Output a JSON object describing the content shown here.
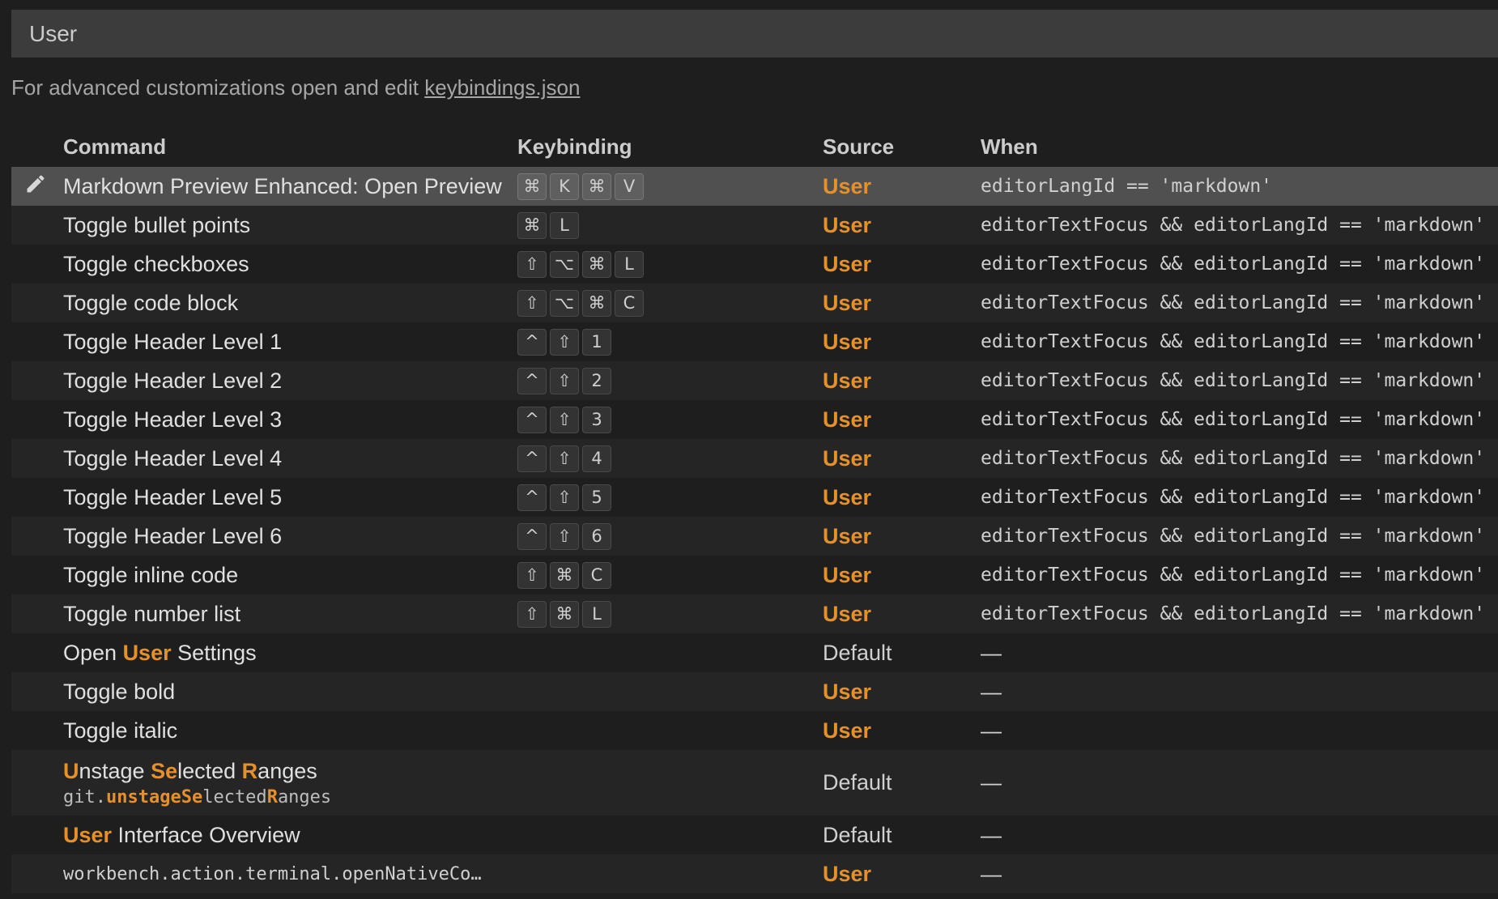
{
  "search": {
    "value": "User"
  },
  "hint": {
    "text": "For advanced customizations open and edit ",
    "link": "keybindings.json"
  },
  "columns": {
    "command": "Command",
    "keybinding": "Keybinding",
    "source": "Source",
    "when": "When"
  },
  "colors": {
    "accent": "#e7902a",
    "background": "#1e1e1e",
    "selected_row": "#505050"
  },
  "rows": [
    {
      "command": "Markdown Preview Enhanced: Open Preview",
      "keys": [
        "⌘",
        "K",
        "⌘",
        "V"
      ],
      "source": "User",
      "when": "editorLangId == 'markdown'",
      "selected": true,
      "icon": "pencil-icon"
    },
    {
      "command": "Toggle bullet points",
      "keys": [
        "⌘",
        "L"
      ],
      "source": "User",
      "when": "editorTextFocus && editorLangId == 'markdown'"
    },
    {
      "command": "Toggle checkboxes",
      "keys": [
        "⇧",
        "⌥",
        "⌘",
        "L"
      ],
      "source": "User",
      "when": "editorTextFocus && editorLangId == 'markdown'"
    },
    {
      "command": "Toggle code block",
      "keys": [
        "⇧",
        "⌥",
        "⌘",
        "C"
      ],
      "source": "User",
      "when": "editorTextFocus && editorLangId == 'markdown'"
    },
    {
      "command": "Toggle Header Level 1",
      "keys": [
        "^",
        "⇧",
        "1"
      ],
      "source": "User",
      "when": "editorTextFocus && editorLangId == 'markdown'"
    },
    {
      "command": "Toggle Header Level 2",
      "keys": [
        "^",
        "⇧",
        "2"
      ],
      "source": "User",
      "when": "editorTextFocus && editorLangId == 'markdown'"
    },
    {
      "command": "Toggle Header Level 3",
      "keys": [
        "^",
        "⇧",
        "3"
      ],
      "source": "User",
      "when": "editorTextFocus && editorLangId == 'markdown'"
    },
    {
      "command": "Toggle Header Level 4",
      "keys": [
        "^",
        "⇧",
        "4"
      ],
      "source": "User",
      "when": "editorTextFocus && editorLangId == 'markdown'"
    },
    {
      "command": "Toggle Header Level 5",
      "keys": [
        "^",
        "⇧",
        "5"
      ],
      "source": "User",
      "when": "editorTextFocus && editorLangId == 'markdown'"
    },
    {
      "command": "Toggle Header Level 6",
      "keys": [
        "^",
        "⇧",
        "6"
      ],
      "source": "User",
      "when": "editorTextFocus && editorLangId == 'markdown'"
    },
    {
      "command": "Toggle inline code",
      "keys": [
        "⇧",
        "⌘",
        "C"
      ],
      "source": "User",
      "when": "editorTextFocus && editorLangId == 'markdown'"
    },
    {
      "command": "Toggle number list",
      "keys": [
        "⇧",
        "⌘",
        "L"
      ],
      "source": "User",
      "when": "editorTextFocus && editorLangId == 'markdown'"
    },
    {
      "command_parts": [
        {
          "t": "Open "
        },
        {
          "t": "User",
          "hl": true
        },
        {
          "t": " Settings"
        }
      ],
      "keys": [],
      "source": "Default",
      "when": "—"
    },
    {
      "command": "Toggle bold",
      "keys": [],
      "source": "User",
      "when": "—"
    },
    {
      "command": "Toggle italic",
      "keys": [],
      "source": "User",
      "when": "—"
    },
    {
      "command_parts": [
        {
          "t": "U",
          "hl": true
        },
        {
          "t": "nstage "
        },
        {
          "t": "Se",
          "hl": true
        },
        {
          "t": "lected "
        },
        {
          "t": "R",
          "hl": true
        },
        {
          "t": "anges"
        }
      ],
      "command_id_parts": [
        {
          "t": "git."
        },
        {
          "t": "unstage",
          "hl": true
        },
        {
          "t": "Se",
          "hl": true
        },
        {
          "t": "lected"
        },
        {
          "t": "R",
          "hl": true
        },
        {
          "t": "anges"
        }
      ],
      "keys": [],
      "source": "Default",
      "when": "—",
      "tall": true
    },
    {
      "command_parts": [
        {
          "t": "User",
          "hl": true
        },
        {
          "t": " Interface Overview"
        }
      ],
      "keys": [],
      "source": "Default",
      "when": "—"
    },
    {
      "command_mono": "workbench.action.terminal.openNativeCo…",
      "keys": [],
      "source": "User",
      "when": "—"
    }
  ]
}
